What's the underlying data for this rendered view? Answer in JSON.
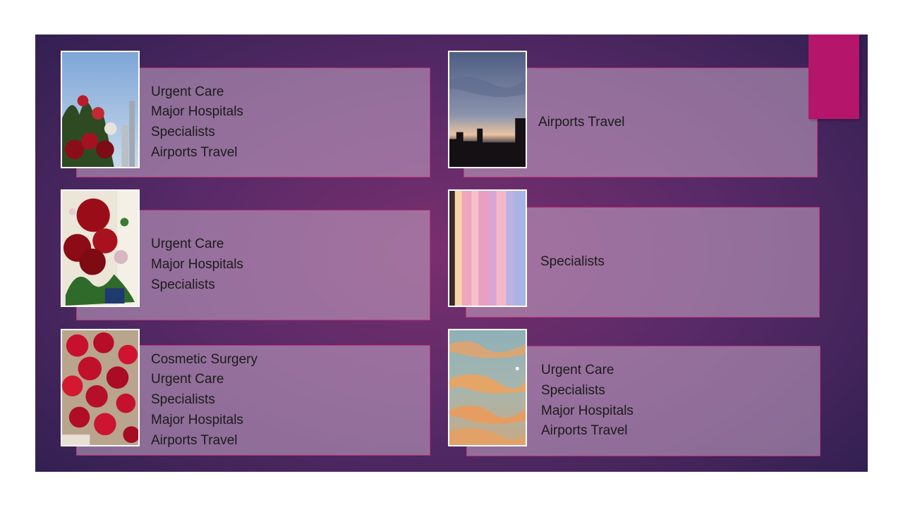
{
  "cards": [
    {
      "image": "red-tulips-city-photo",
      "lines": [
        "Urgent Care",
        "Major Hospitals",
        "Specialists",
        "Airports Travel"
      ]
    },
    {
      "image": "city-sunset-skyline-photo",
      "lines": [
        "Airports Travel"
      ]
    },
    {
      "image": "red-roses-bouquet-photo",
      "lines": [
        "Urgent Care",
        "Major Hospitals",
        "Specialists"
      ]
    },
    {
      "image": "pink-sky-streaks-photo",
      "lines": [
        "Specialists"
      ]
    },
    {
      "image": "red-roses-cluster-photo",
      "lines": [
        "Cosmetic Surgery",
        "Urgent Care",
        "Specialists",
        "Major Hospitals",
        "Airports Travel"
      ]
    },
    {
      "image": "orange-clouds-sky-photo",
      "lines": [
        "Urgent Care",
        "Specialists",
        "Major Hospitals",
        "Airports Travel"
      ]
    }
  ],
  "colors": {
    "accent": "#b5156a",
    "panel_border": "#c0337a",
    "background_center": "#7a2f6e",
    "background_edge": "#2e1f4f"
  }
}
